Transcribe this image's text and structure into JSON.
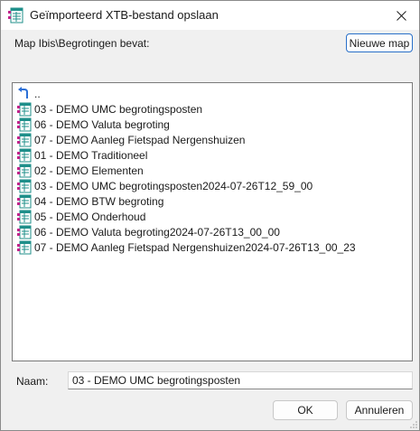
{
  "window": {
    "title": "Geïmporteerd XTB-bestand opslaan"
  },
  "header": {
    "folder_label": "Map Ibis\\Begrotingen bevat:",
    "new_folder_label": "Nieuwe map"
  },
  "files": [
    {
      "label": "..",
      "icon": "up-folder-icon"
    },
    {
      "label": "03 - DEMO UMC begrotingsposten",
      "icon": "budget-file-icon"
    },
    {
      "label": "06 - DEMO Valuta begroting",
      "icon": "budget-file-icon"
    },
    {
      "label": "07 - DEMO Aanleg Fietspad Nergenshuizen",
      "icon": "budget-file-icon"
    },
    {
      "label": "01 - DEMO Traditioneel",
      "icon": "budget-file-icon"
    },
    {
      "label": "02 - DEMO Elementen",
      "icon": "budget-file-icon"
    },
    {
      "label": "03 - DEMO UMC begrotingsposten2024-07-26T12_59_00",
      "icon": "budget-file-icon"
    },
    {
      "label": "04 - DEMO BTW begroting",
      "icon": "budget-file-icon"
    },
    {
      "label": "05 - DEMO Onderhoud",
      "icon": "budget-file-icon"
    },
    {
      "label": "06 - DEMO Valuta begroting2024-07-26T13_00_00",
      "icon": "budget-file-icon"
    },
    {
      "label": "07 - DEMO Aanleg Fietspad Nergenshuizen2024-07-26T13_00_23",
      "icon": "budget-file-icon"
    }
  ],
  "name_field": {
    "label": "Naam:",
    "value": "03 - DEMO UMC begrotingsposten"
  },
  "buttons": {
    "ok": "OK",
    "cancel": "Annuleren"
  },
  "colors": {
    "accent": "#2a70c9",
    "icon_teal": "#1f8f8a",
    "icon_magenta": "#c0238a",
    "up_arrow_blue": "#2b6fd6"
  }
}
